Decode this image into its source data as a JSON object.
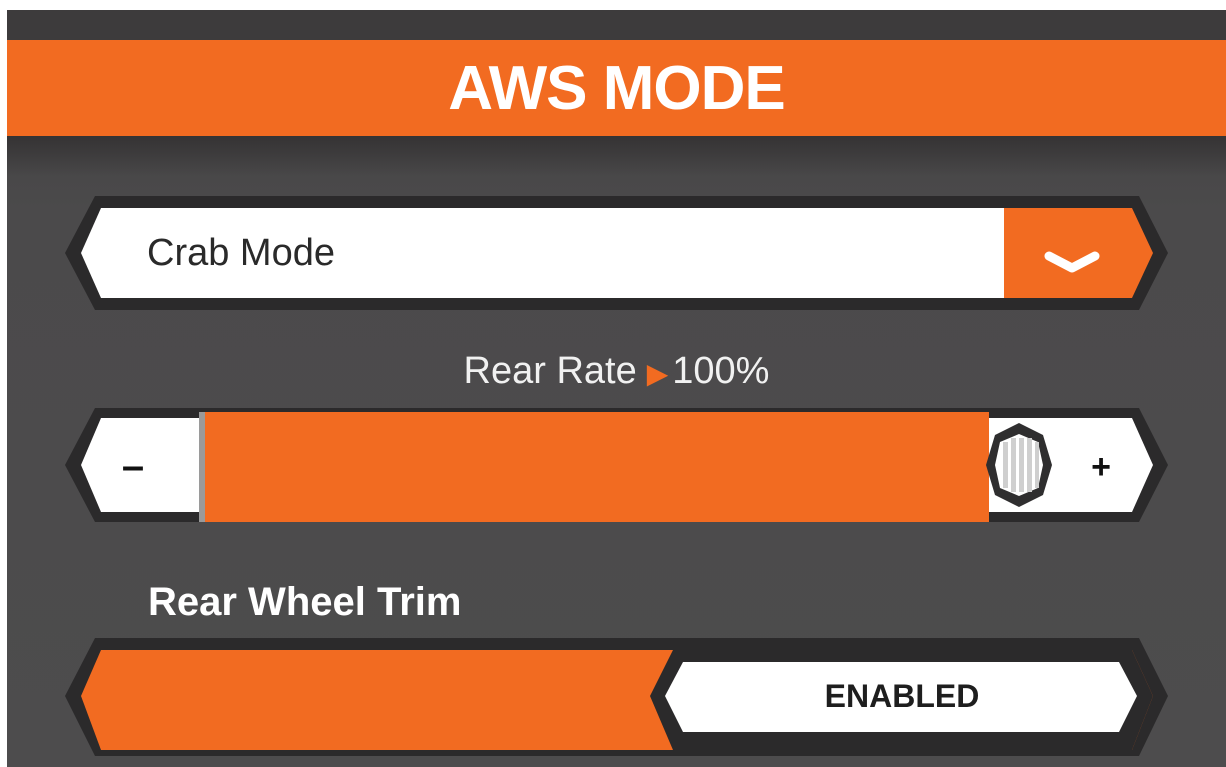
{
  "header": {
    "title": "AWS MODE"
  },
  "mode_select": {
    "value": "Crab Mode",
    "icon": "chevron-down-icon"
  },
  "rear_rate": {
    "label": "Rear Rate",
    "value_text": "100%",
    "value": 100
  },
  "slider": {
    "minus_label": "–",
    "plus_label": "+",
    "handle_icon": "hexagon-grip-icon"
  },
  "rear_wheel_trim": {
    "label": "Rear Wheel Trim",
    "toggle_label": "ENABLED",
    "enabled": true
  },
  "colors": {
    "accent": "#f26b21",
    "background": "#4b4a4b",
    "surface": "#ffffff",
    "dark": "#2b2a2b"
  }
}
